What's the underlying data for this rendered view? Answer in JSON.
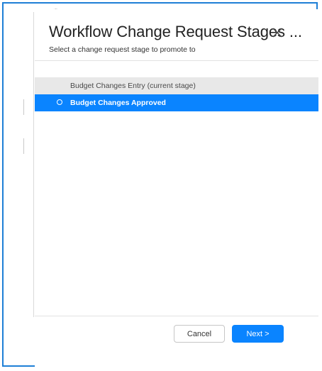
{
  "dialog": {
    "title": "Workflow Change Request Stages ...",
    "subtitle": "Select a change request stage to promote to",
    "close_icon": "close-icon"
  },
  "stages": [
    {
      "label": "Budget Changes Entry (current stage)",
      "state": "current"
    },
    {
      "label": "Budget Changes Approved",
      "state": "selected"
    }
  ],
  "footer": {
    "cancel_label": "Cancel",
    "next_label": "Next >"
  },
  "colors": {
    "accent": "#0a84ff",
    "frame_border": "#1e7fd6",
    "current_row_bg": "#e8e8e8"
  }
}
